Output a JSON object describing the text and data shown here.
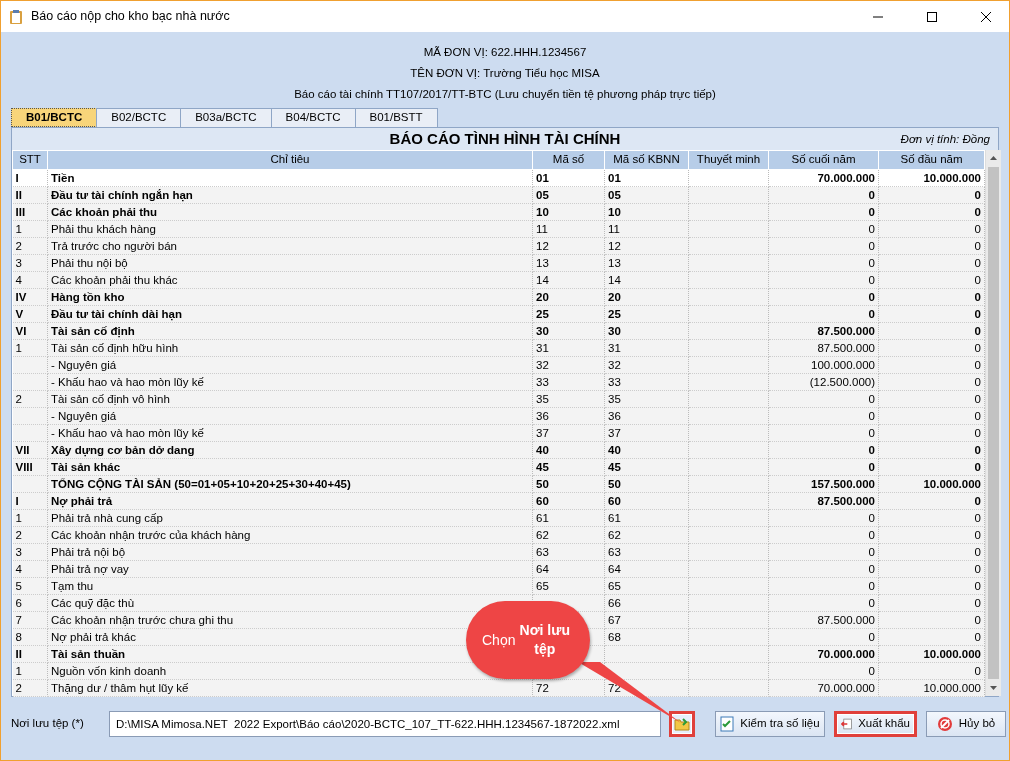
{
  "window": {
    "title": "Báo cáo nộp cho kho bạc nhà nước"
  },
  "header": [
    "MÃ ĐƠN VỊ: 622.HHH.1234567",
    "TÊN ĐƠN VỊ: Trường Tiểu học MISA",
    "Báo cáo tài chính TT107/2017/TT-BTC (Lưu chuyển tiền tệ phương pháp trực tiếp)"
  ],
  "tabs": [
    {
      "label": "B01/BCTC",
      "selected": true
    },
    {
      "label": "B02/BCTC",
      "selected": false
    },
    {
      "label": "B03a/BCTC",
      "selected": false
    },
    {
      "label": "B04/BCTC",
      "selected": false
    },
    {
      "label": "B01/BSTT",
      "selected": false
    }
  ],
  "report": {
    "title": "BÁO CÁO TÌNH HÌNH TÀI CHÍNH",
    "unit": "Đơn vị tính: Đồng"
  },
  "table": {
    "columns": [
      "STT",
      "Chỉ tiêu",
      "Mã số",
      "Mã số KBNN",
      "Thuyết minh",
      "Số cuối năm",
      "Số đầu năm"
    ],
    "rows": [
      {
        "kind": "group",
        "stt": "I",
        "name": "Tiền",
        "ma_so": "01",
        "kbnn": "01",
        "end": "70.000.000",
        "start": "10.000.000",
        "selected": true
      },
      {
        "kind": "group",
        "stt": "II",
        "name": "Đầu tư tài chính ngắn hạn",
        "ma_so": "05",
        "kbnn": "05",
        "end": "0",
        "start": "0",
        "selected": false
      },
      {
        "kind": "group",
        "stt": "III",
        "name": "Các khoản phải thu",
        "ma_so": "10",
        "kbnn": "10",
        "end": "0",
        "start": "0",
        "selected": false
      },
      {
        "kind": "item",
        "stt": "1",
        "name": "Phải thu khách hàng",
        "ma_so": "11",
        "kbnn": "11",
        "end": "0",
        "start": "0",
        "selected": false
      },
      {
        "kind": "item",
        "stt": "2",
        "name": "Trả trước cho người bán",
        "ma_so": "12",
        "kbnn": "12",
        "end": "0",
        "start": "0",
        "selected": false
      },
      {
        "kind": "item",
        "stt": "3",
        "name": "Phải thu nội bộ",
        "ma_so": "13",
        "kbnn": "13",
        "end": "0",
        "start": "0",
        "selected": false
      },
      {
        "kind": "item",
        "stt": "4",
        "name": "Các khoản phải thu khác",
        "ma_so": "14",
        "kbnn": "14",
        "end": "0",
        "start": "0",
        "selected": false
      },
      {
        "kind": "group",
        "stt": "IV",
        "name": "Hàng tồn kho",
        "ma_so": "20",
        "kbnn": "20",
        "end": "0",
        "start": "0",
        "selected": false
      },
      {
        "kind": "group",
        "stt": "V",
        "name": "Đầu tư tài chính dài hạn",
        "ma_so": "25",
        "kbnn": "25",
        "end": "0",
        "start": "0",
        "selected": false
      },
      {
        "kind": "group",
        "stt": "VI",
        "name": "Tài sản cố định",
        "ma_so": "30",
        "kbnn": "30",
        "end": "87.500.000",
        "start": "0",
        "selected": false
      },
      {
        "kind": "item",
        "stt": "1",
        "name": "Tài sản cố định hữu hình",
        "ma_so": "31",
        "kbnn": "31",
        "end": "87.500.000",
        "start": "0",
        "selected": false
      },
      {
        "kind": "item",
        "name": "- Nguyên giá",
        "ma_so": "32",
        "kbnn": "32",
        "end": "100.000.000",
        "start": "0",
        "selected": false
      },
      {
        "kind": "item",
        "name": "- Khấu hao và hao mòn lũy kế",
        "ma_so": "33",
        "kbnn": "33",
        "end": "(12.500.000)",
        "start": "0",
        "selected": false
      },
      {
        "kind": "item",
        "stt": "2",
        "name": "Tài sản cố định vô hình",
        "ma_so": "35",
        "kbnn": "35",
        "end": "0",
        "start": "0",
        "selected": false
      },
      {
        "kind": "item",
        "name": "- Nguyên giá",
        "ma_so": "36",
        "kbnn": "36",
        "end": "0",
        "start": "0",
        "selected": false
      },
      {
        "kind": "item",
        "name": "- Khấu hao và hao mòn lũy kế",
        "ma_so": "37",
        "kbnn": "37",
        "end": "0",
        "start": "0",
        "selected": false
      },
      {
        "kind": "group",
        "stt": "VII",
        "name": "Xây dựng cơ bản dở dang",
        "ma_so": "40",
        "kbnn": "40",
        "end": "0",
        "start": "0",
        "selected": false
      },
      {
        "kind": "group",
        "stt": "VIII",
        "name": "Tài sản khác",
        "ma_so": "45",
        "kbnn": "45",
        "end": "0",
        "start": "0",
        "selected": false
      },
      {
        "kind": "group",
        "name": "TỔNG CỘNG TÀI SẢN (50=01+05+10+20+25+30+40+45)",
        "ma_so": "50",
        "kbnn": "50",
        "end": "157.500.000",
        "start": "10.000.000",
        "selected": false
      },
      {
        "kind": "group",
        "stt": "I",
        "name": "Nợ phải trả",
        "ma_so": "60",
        "kbnn": "60",
        "end": "87.500.000",
        "start": "0",
        "selected": false
      },
      {
        "kind": "item",
        "stt": "1",
        "name": "Phải trả nhà cung cấp",
        "ma_so": "61",
        "kbnn": "61",
        "end": "0",
        "start": "0",
        "selected": false
      },
      {
        "kind": "item",
        "stt": "2",
        "name": "Các khoản nhận trước của khách hàng",
        "ma_so": "62",
        "kbnn": "62",
        "end": "0",
        "start": "0",
        "selected": false
      },
      {
        "kind": "item",
        "stt": "3",
        "name": "Phải trả nội bộ",
        "ma_so": "63",
        "kbnn": "63",
        "end": "0",
        "start": "0",
        "selected": false
      },
      {
        "kind": "item",
        "stt": "4",
        "name": "Phải trả nợ vay",
        "ma_so": "64",
        "kbnn": "64",
        "end": "0",
        "start": "0",
        "selected": false
      },
      {
        "kind": "item",
        "stt": "5",
        "name": "Tạm thu",
        "ma_so": "65",
        "kbnn": "65",
        "end": "0",
        "start": "0",
        "selected": false
      },
      {
        "kind": "item",
        "stt": "6",
        "name": "Các quỹ đặc thù",
        "kbnn": "66",
        "end": "0",
        "start": "0",
        "selected": false
      },
      {
        "kind": "item",
        "stt": "7",
        "name": "Các khoản nhận trước chưa ghi thu",
        "kbnn": "67",
        "end": "87.500.000",
        "start": "0",
        "selected": false
      },
      {
        "kind": "item",
        "stt": "8",
        "name": "Nợ phải trả khác",
        "kbnn": "68",
        "end": "0",
        "start": "0",
        "selected": false
      },
      {
        "kind": "group",
        "stt": "II",
        "name": "Tài sản thuần",
        "end": "70.000.000",
        "start": "10.000.000",
        "selected": false
      },
      {
        "kind": "item",
        "stt": "1",
        "name": "Nguồn vốn kinh doanh",
        "end": "0",
        "start": "0",
        "selected": false
      },
      {
        "kind": "item",
        "stt": "2",
        "name": "Thặng dư / thâm hụt lũy kế",
        "ma_so": "72",
        "kbnn": "72",
        "end": "70.000.000",
        "start": "10.000.000",
        "selected": false
      }
    ]
  },
  "save_path": {
    "label": "Nơi lưu tệp (*)",
    "value": "D:\\MISA Mimosa.NET  2022 Export\\Báo cáo\\2020-BCTC_107_TT-622.HHH.1234567-1872022.xml",
    "browse_highlighted": true
  },
  "buttons": [
    {
      "kind": "check",
      "label": "Kiểm tra số liệu",
      "highlighted": false
    },
    {
      "kind": "export",
      "label": "Xuất khẩu",
      "highlighted": true
    },
    {
      "kind": "cancel",
      "label": "Hủy bỏ",
      "highlighted": false
    }
  ],
  "callout": {
    "text": "Chọn **Nơi lưu tệp**"
  }
}
